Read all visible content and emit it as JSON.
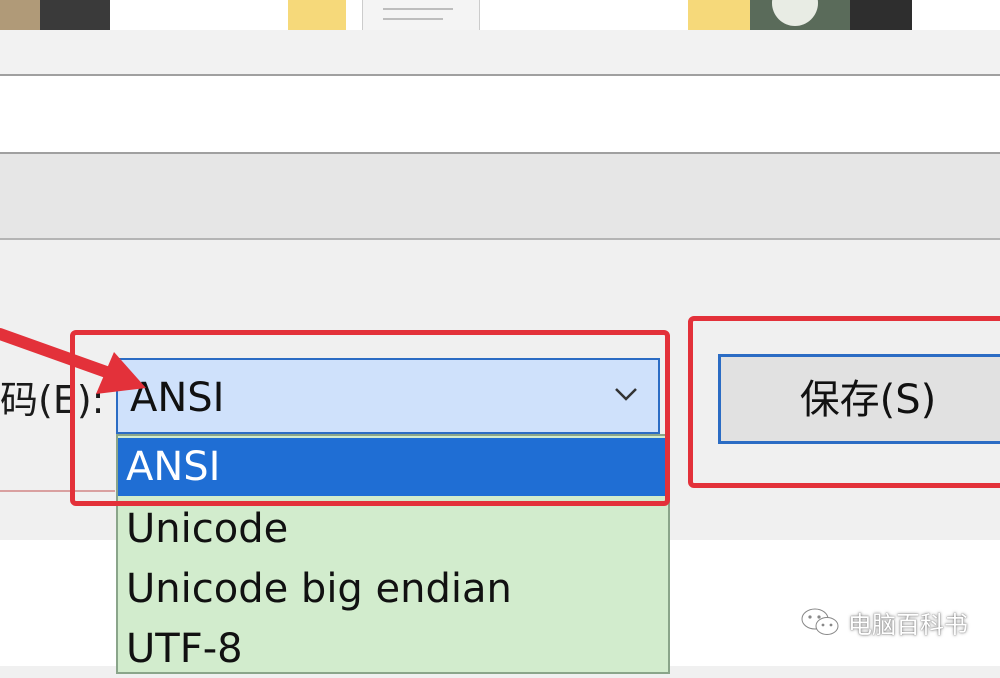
{
  "dialog": {
    "encoding_label": "码(E):",
    "encoding_select": {
      "selected": "ANSI",
      "options": [
        "ANSI",
        "Unicode",
        "Unicode big endian",
        "UTF-8"
      ]
    },
    "save_button": "保存(S)"
  },
  "watermark": "电脑百科书",
  "colors": {
    "highlight": "#e3313a",
    "selection": "#1f6ed4",
    "dropdown_bg": "#d2eccd",
    "combo_bg": "#cfe1fb",
    "focus_border": "#2b6cc4"
  },
  "icons": [
    "chevron-down-icon",
    "red-arrow-pointer",
    "wechat-logo"
  ]
}
